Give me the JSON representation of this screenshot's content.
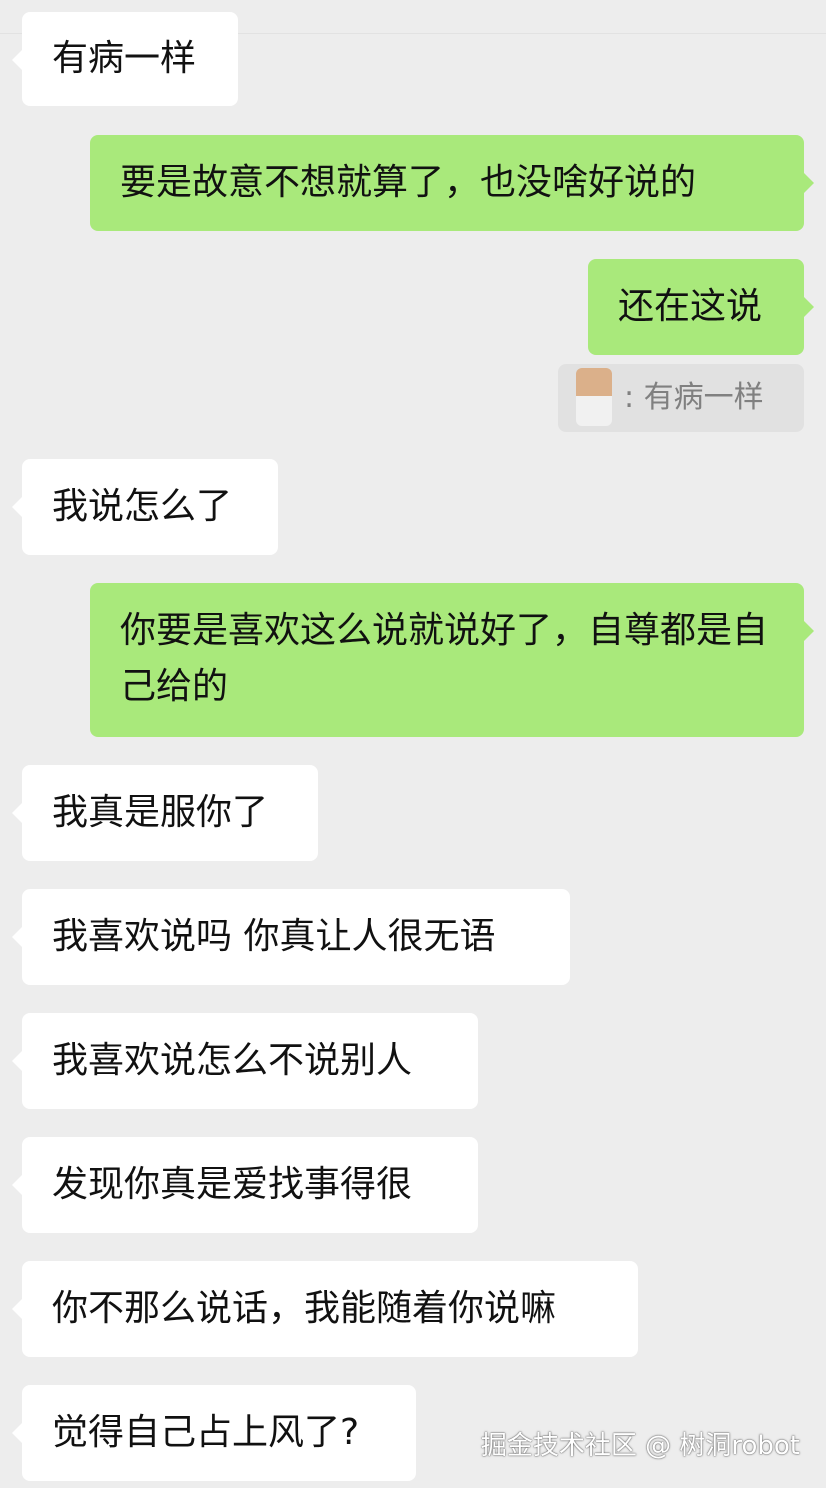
{
  "messages": [
    {
      "from": "them",
      "text": "有病一样"
    },
    {
      "from": "me",
      "text": "要是故意不想就算了，也没啥好说的"
    },
    {
      "from": "me",
      "text": "还在这说"
    },
    {
      "from": "them",
      "text": "我说怎么了"
    },
    {
      "from": "me",
      "text": "你要是喜欢这么说就说好了，自尊都是自己给的"
    },
    {
      "from": "them",
      "text": "我真是服你了"
    },
    {
      "from": "them",
      "text": "我喜欢说吗 你真让人很无语"
    },
    {
      "from": "them",
      "text": "我喜欢说怎么不说别人"
    },
    {
      "from": "them",
      "text": "发现你真是爱找事得很"
    },
    {
      "from": "them",
      "text": "你不那么说话，我能随着你说嘛"
    },
    {
      "from": "them",
      "text": "觉得自己占上风了?"
    }
  ],
  "quote": {
    "text": ": 有病一样"
  },
  "watermark": "掘金技术社区 @ 树洞robot",
  "colors": {
    "background": "#ededed",
    "incoming_bubble": "#ffffff",
    "outgoing_bubble": "#a9e97b",
    "quote_box": "#e1e1e1",
    "quote_text": "#808080"
  }
}
